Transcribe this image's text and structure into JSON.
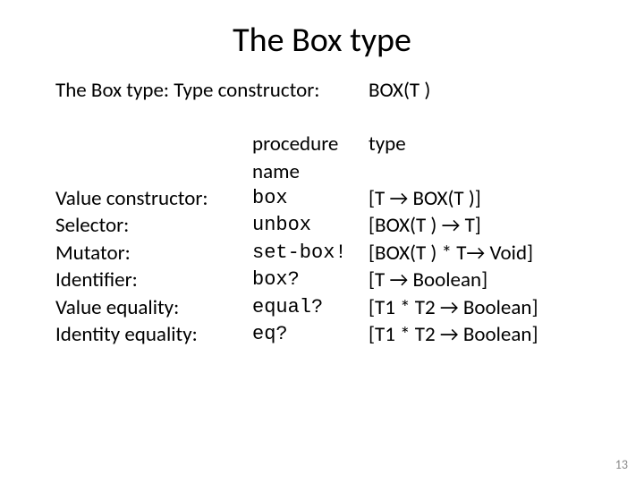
{
  "title": "The Box type",
  "topline": {
    "label": "The Box type:  Type constructor:",
    "value": "BOX(T )"
  },
  "header": {
    "proc": "procedure name",
    "type": "type"
  },
  "rows": [
    {
      "label": "Value constructor:",
      "proc": "box",
      "type": "[T → BOX(T )]"
    },
    {
      "label": "Selector:",
      "proc": "unbox",
      "type": "[BOX(T ) → T]"
    },
    {
      "label": "Mutator:",
      "proc": "set-box!",
      "type": "[BOX(T ) * T→ Void]"
    },
    {
      "label": "Identifier:",
      "proc": "box?",
      "type": "[T → Boolean]"
    },
    {
      "label": "Value equality:",
      "proc": "equal?",
      "type": "[T1 * T2 → Boolean]"
    },
    {
      "label": "Identity equality:",
      "proc": "eq?",
      "type": "[T1 * T2 → Boolean]"
    }
  ],
  "pagenum": "13"
}
